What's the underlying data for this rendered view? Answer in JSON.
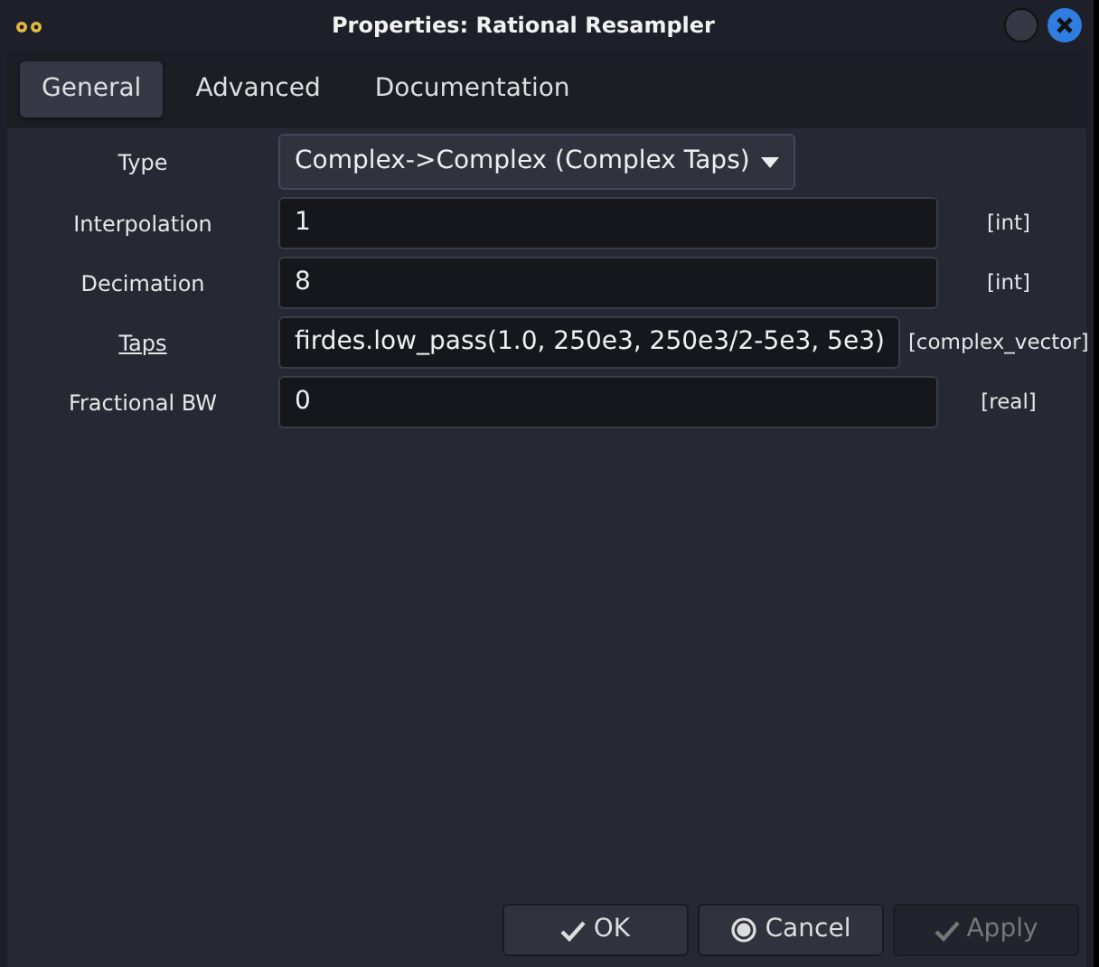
{
  "window": {
    "title": "Properties: Rational Resampler"
  },
  "tabs": [
    {
      "label": "General",
      "selected": true
    },
    {
      "label": "Advanced",
      "selected": false
    },
    {
      "label": "Documentation",
      "selected": false
    }
  ],
  "params": [
    {
      "kind": "dropdown",
      "label": "Type",
      "value": "Complex->Complex (Complex Taps)",
      "underlined": false
    },
    {
      "kind": "entry",
      "label": "Interpolation",
      "value": "1",
      "unit": "[int]",
      "underlined": false
    },
    {
      "kind": "entry",
      "label": "Decimation",
      "value": "8",
      "unit": "[int]",
      "underlined": false
    },
    {
      "kind": "entry",
      "label": "Taps",
      "value": "firdes.low_pass(1.0, 250e3, 250e3/2-5e3, 5e3)",
      "unit": "[complex_vector]",
      "underlined": true
    },
    {
      "kind": "entry",
      "label": "Fractional BW",
      "value": "0",
      "unit": "[real]",
      "underlined": false
    }
  ],
  "buttons": [
    {
      "kind": "check",
      "label": "OK",
      "disabled": false
    },
    {
      "kind": "ring",
      "label": "Cancel",
      "disabled": false
    },
    {
      "kind": "check",
      "label": "Apply",
      "disabled": true
    }
  ]
}
